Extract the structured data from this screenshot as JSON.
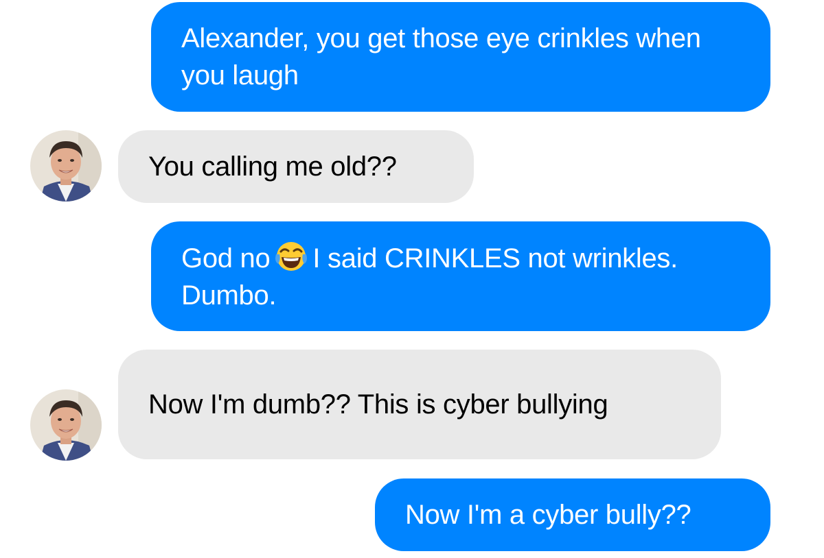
{
  "conversation": {
    "colors": {
      "outgoing_bubble": "#0084ff",
      "incoming_bubble": "#e9e9e9",
      "outgoing_text": "#ffffff",
      "incoming_text": "#000000"
    },
    "messages": [
      {
        "sender": "me",
        "text": "Alexander, you get those eye crinkles when you laugh"
      },
      {
        "sender": "contact",
        "text": "You calling me old??"
      },
      {
        "sender": "me",
        "text_before_emoji": "God no",
        "emoji": "face-with-tears-of-joy-icon",
        "text_after_emoji": "I said CRINKLES not wrinkles. Dumbo."
      },
      {
        "sender": "contact",
        "text": "Now I'm dumb?? This is cyber bullying"
      },
      {
        "sender": "me",
        "text": "Now I'm a cyber bully??"
      }
    ]
  }
}
